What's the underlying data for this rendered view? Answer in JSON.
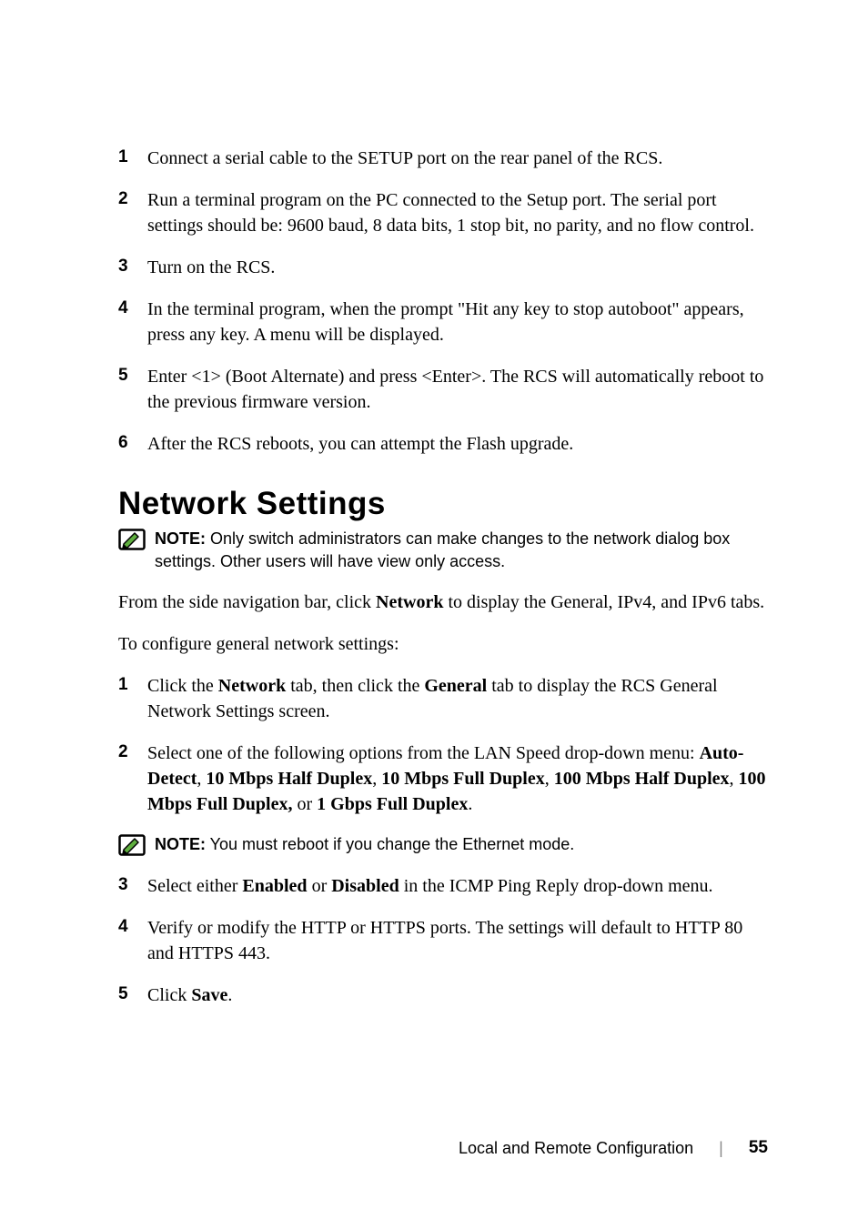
{
  "list1": {
    "i1": {
      "num": "1",
      "text": "Connect a serial cable to the SETUP port on the rear panel of the RCS."
    },
    "i2": {
      "num": "2",
      "text": "Run a terminal program on the PC connected to the Setup port. The serial port settings should be: 9600 baud, 8 data bits, 1 stop bit, no parity, and no flow control."
    },
    "i3": {
      "num": "3",
      "text": "Turn on the RCS."
    },
    "i4": {
      "num": "4",
      "text": "In the terminal program, when the prompt \"Hit any key to stop autoboot\" appears, press any key. A menu will be displayed."
    },
    "i5": {
      "num": "5",
      "text": "Enter <1> (Boot Alternate) and press <Enter>. The RCS will automatically reboot to the previous firmware version."
    },
    "i6": {
      "num": "6",
      "text": "After the RCS reboots, you can attempt the Flash upgrade."
    }
  },
  "heading": "Network Settings",
  "note1": {
    "label": "NOTE:",
    "text": " Only switch administrators can make changes to the network dialog box settings. Other users will have view only access."
  },
  "para1_a": "From the side navigation bar, click ",
  "para1_b": "Network",
  "para1_c": " to display the General, IPv4, and IPv6 tabs.",
  "para2": "To configure general network settings:",
  "list2": {
    "i1": {
      "num": "1",
      "a": "Click the ",
      "b": "Network",
      "c": " tab, then click the ",
      "d": "General",
      "e": " tab to display the RCS General Network Settings screen."
    },
    "i2": {
      "num": "2",
      "a": "Select one of the following options from the LAN Speed drop-down menu: ",
      "b": "Auto-Detect",
      "c": ", ",
      "d": "10 Mbps Half Duplex",
      "e": ", ",
      "f": "10 Mbps Full Duplex",
      "g": ", ",
      "h": "100 Mbps Half Duplex",
      "i": ", ",
      "j": "100 Mbps Full Duplex,",
      "k": " or ",
      "l": "1 Gbps Full Duplex",
      "m": "."
    },
    "i3": {
      "num": "3",
      "a": "Select either ",
      "b": "Enabled",
      "c": " or ",
      "d": "Disabled",
      "e": " in the ICMP Ping Reply drop-down menu."
    },
    "i4": {
      "num": "4",
      "text": "Verify or modify the HTTP or HTTPS ports. The settings will default to HTTP 80 and HTTPS 443."
    },
    "i5": {
      "num": "5",
      "a": "Click ",
      "b": "Save",
      "c": "."
    }
  },
  "note2": {
    "label": "NOTE:",
    "text": " You must reboot if you change the Ethernet mode."
  },
  "footer": {
    "title": "Local and Remote Configuration",
    "page": "55"
  },
  "chart_data": null
}
